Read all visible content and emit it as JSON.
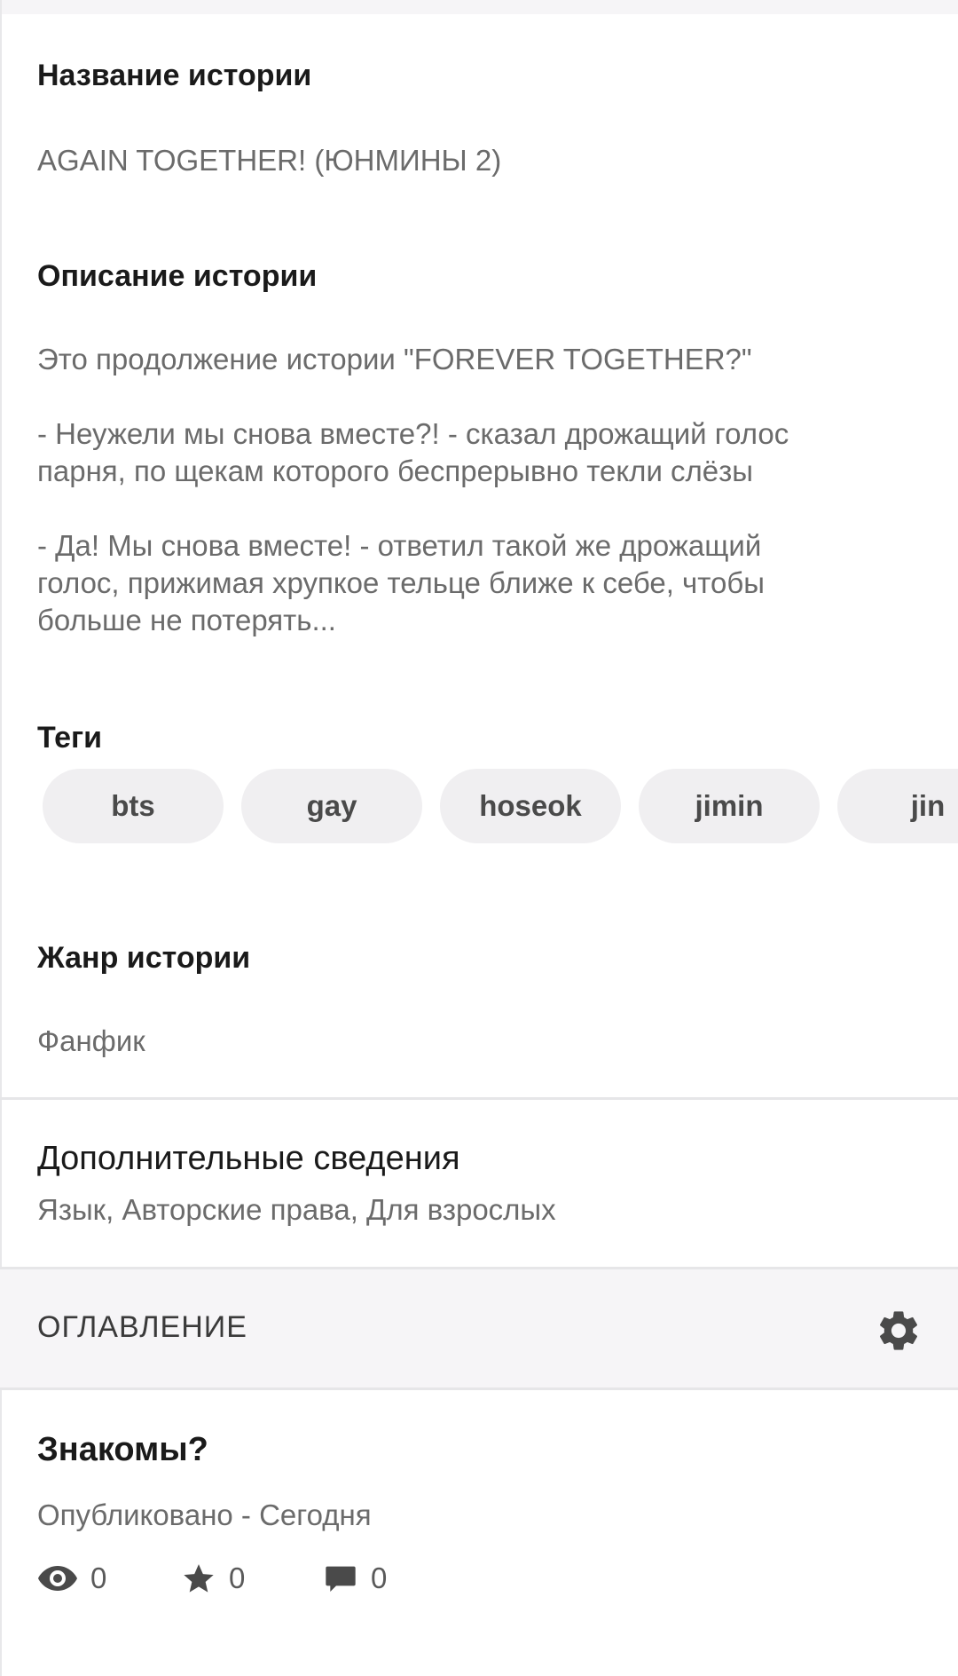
{
  "story": {
    "title_label": "Название истории",
    "title_value": "AGAIN TOGETHER! (ЮНМИНЫ 2)",
    "description_label": "Описание истории",
    "description_paragraphs": [
      "Это продолжение истории \"FOREVER TOGETHER?\"",
      "- Неужели мы снова вместе?! - сказал дрожащий голос\nпарня, по щекам которого беспрерывно текли слёзы",
      "- Да! Мы снова вместе! - ответил такой же дрожащий\nголос, прижимая хрупкое тельце ближе к себе, чтобы\nбольше не потерять..."
    ],
    "tags_label": "Теги",
    "tags": [
      "bts",
      "gay",
      "hoseok",
      "jimin",
      "jin"
    ],
    "genre_label": "Жанр истории",
    "genre_value": "Фанфик"
  },
  "extra_info": {
    "title": "Дополнительные сведения",
    "subtitle": "Язык, Авторские права, Для взрослых"
  },
  "toc": {
    "label": "ОГЛАВЛЕНИЕ",
    "settings_icon": "gear-icon"
  },
  "chapter": {
    "title": "Знакомы?",
    "published": "Опубликовано - Сегодня",
    "views": "0",
    "votes": "0",
    "comments": "0"
  },
  "colors": {
    "heading": "#1a1a1a",
    "secondary_text": "#6b6b6b",
    "tag_background": "#f0eff1",
    "section_background": "#f6f5f7",
    "icon": "#4a4a4a"
  }
}
